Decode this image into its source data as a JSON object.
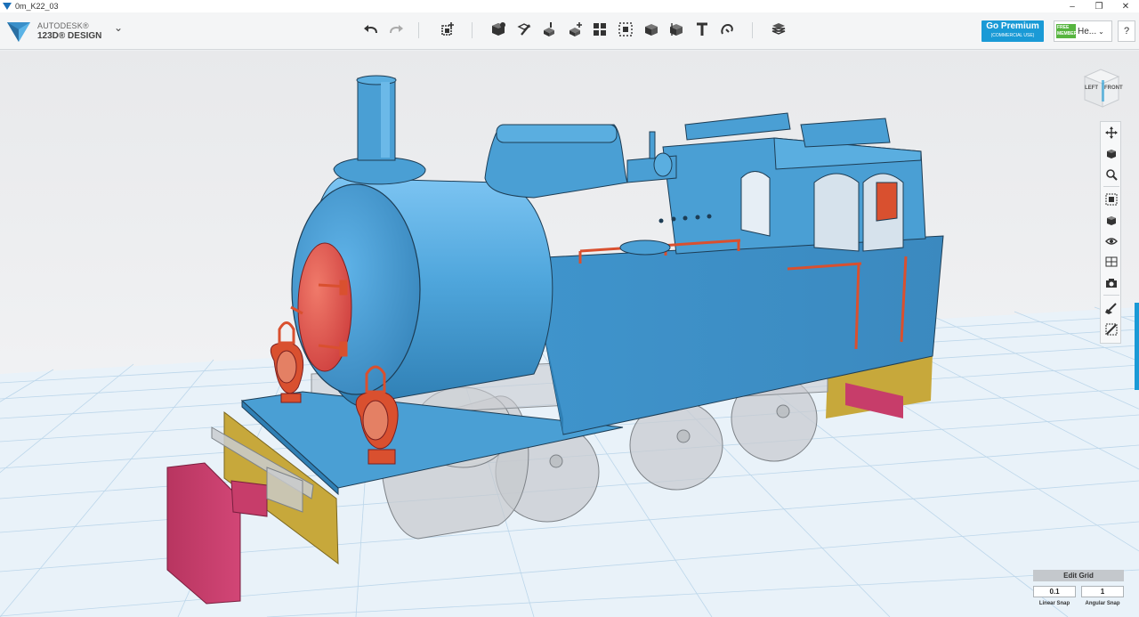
{
  "window": {
    "title": "0m_K22_03",
    "controls": [
      "minimize-icon",
      "maximize-icon",
      "close-icon"
    ]
  },
  "logo": {
    "brand": "AUTODESK®",
    "product": "123D® DESIGN"
  },
  "toolbar": {
    "tools": [
      "undo-icon",
      "redo-icon",
      "transform-icon",
      "primitives-icon",
      "sketch-icon",
      "construct-icon",
      "modify-icon",
      "pattern-icon",
      "group-icon",
      "combine-icon",
      "measure-icon",
      "text-icon",
      "snap-icon",
      "material-icon"
    ]
  },
  "account": {
    "premium_label": "Go Premium",
    "premium_sub": "(COMMERCIAL USE)",
    "member_badge_line1": "FREE",
    "member_badge_line2": "MEMBER",
    "member_name": "He...",
    "help_label": "?"
  },
  "viewcube": {
    "left_label": "LEFT",
    "front_label": "FRONT"
  },
  "navbar": {
    "tools": [
      "pan-icon",
      "orbit-icon",
      "zoom-icon",
      "fit-icon",
      "view-mode-icon",
      "visibility-icon",
      "material-view-icon",
      "camera-icon",
      "paint-icon",
      "paint-alt-icon"
    ]
  },
  "edit_grid": {
    "title": "Edit Grid",
    "linear_snap_value": "0.1",
    "angular_snap_value": "1",
    "linear_snap_label": "Linear Snap",
    "angular_snap_label": "Angular Snap"
  },
  "colors": {
    "body_blue": "#4a9fd4",
    "accent_red": "#d9502f",
    "buffer_pink": "#c73d6a",
    "beam_yellow": "#c7a83b",
    "grid_line": "#bcd6ea",
    "premium_blue": "#1a9ad6",
    "member_green": "#57b540"
  }
}
